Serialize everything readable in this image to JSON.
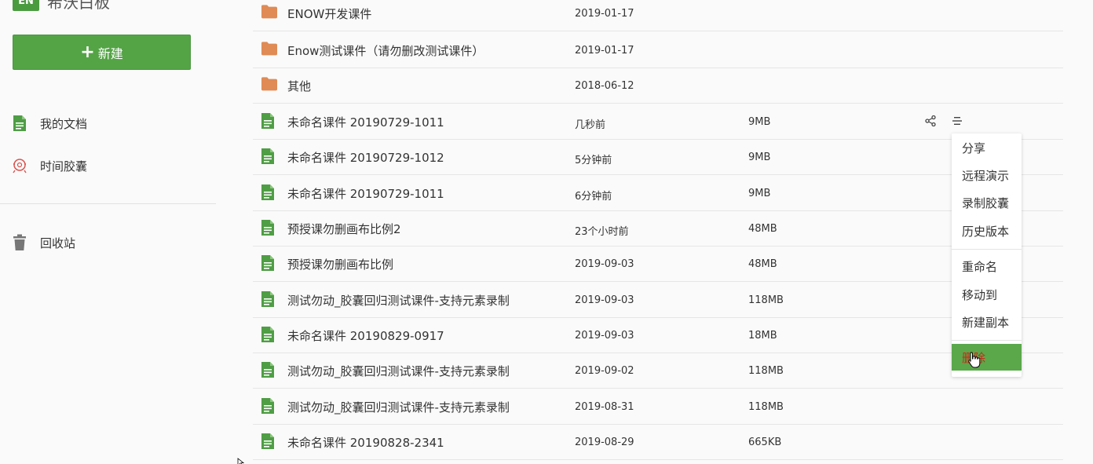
{
  "app": {
    "logo_badge": "EN",
    "logo_text": "希沃白板"
  },
  "sidebar": {
    "new_button": "新建",
    "items": [
      {
        "label": "我的文档",
        "icon": "document-icon"
      },
      {
        "label": "时间胶囊",
        "icon": "capsule-icon"
      },
      {
        "label": "回收站",
        "icon": "trash-icon"
      }
    ]
  },
  "files": [
    {
      "type": "folder",
      "name": "ENOW开发课件",
      "date": "2019-01-17",
      "size": ""
    },
    {
      "type": "folder",
      "name": "Enow测试课件（请勿删改测试课件）",
      "date": "2019-01-17",
      "size": ""
    },
    {
      "type": "folder",
      "name": "其他",
      "date": "2018-06-12",
      "size": ""
    },
    {
      "type": "file",
      "name": "未命名课件 20190729-1011",
      "date": "几秒前",
      "size": "9MB"
    },
    {
      "type": "file",
      "name": "未命名课件 20190729-1012",
      "date": "5分钟前",
      "size": "9MB"
    },
    {
      "type": "file",
      "name": "未命名课件 20190729-1011",
      "date": "6分钟前",
      "size": "9MB"
    },
    {
      "type": "file",
      "name": "预授课勿删画布比例2",
      "date": "23个小时前",
      "size": "48MB"
    },
    {
      "type": "file",
      "name": "预授课勿删画布比例",
      "date": "2019-09-03",
      "size": "48MB"
    },
    {
      "type": "file",
      "name": "测试勿动_胶囊回归测试课件-支持元素录制",
      "date": "2019-09-03",
      "size": "118MB"
    },
    {
      "type": "file",
      "name": "未命名课件 20190829-0917",
      "date": "2019-09-03",
      "size": "18MB"
    },
    {
      "type": "file",
      "name": "测试勿动_胶囊回归测试课件-支持元素录制",
      "date": "2019-09-02",
      "size": "118MB"
    },
    {
      "type": "file",
      "name": "测试勿动_胶囊回归测试课件-支持元素录制",
      "date": "2019-08-31",
      "size": "118MB"
    },
    {
      "type": "file",
      "name": "未命名课件 20190828-2341",
      "date": "2019-08-29",
      "size": "665KB"
    }
  ],
  "row_actions": {
    "share_icon": "share-icon",
    "menu_icon": "menu-icon"
  },
  "context_menu": {
    "group1": [
      "分享",
      "远程演示",
      "录制胶囊",
      "历史版本"
    ],
    "group2": [
      "重命名",
      "移动到",
      "新建副本"
    ],
    "danger": "删除"
  },
  "colors": {
    "brand_green": "#54a446",
    "folder_orange": "#e08a55",
    "danger_red": "#d0261b"
  }
}
